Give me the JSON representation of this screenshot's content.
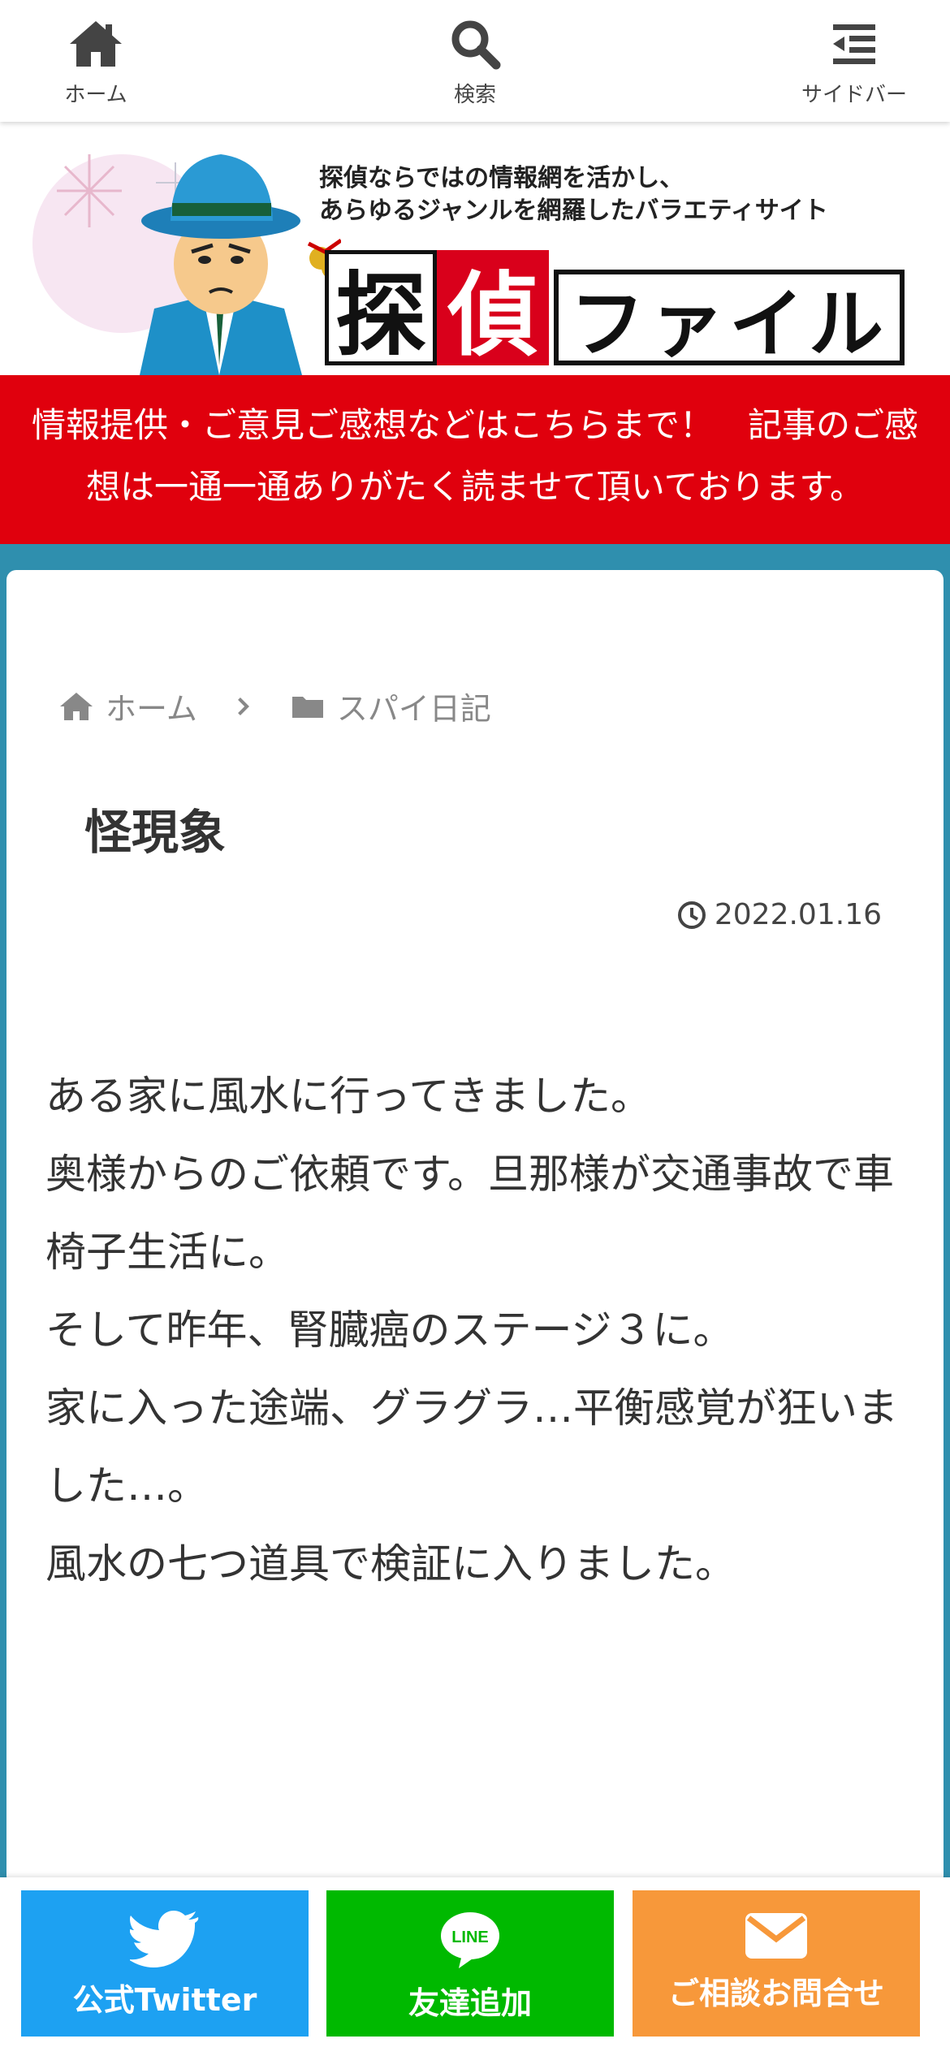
{
  "nav": {
    "home_label": "ホーム",
    "search_label": "検索",
    "sidebar_label": "サイドバー"
  },
  "header": {
    "tagline_line1": "探偵ならではの情報網を活かし、",
    "tagline_line2": "あらゆるジャンルを網羅したバラエティサイト",
    "logo_char1": "探",
    "logo_char2": "偵",
    "logo_kana": "ファイル"
  },
  "notice": {
    "text": "情報提供・ご意見ご感想などはこちらまで！　記事のご感想は一通一通ありがたく読ませて頂いております。"
  },
  "breadcrumb": {
    "home": "ホーム",
    "category": "スパイ日記"
  },
  "post": {
    "title": "怪現象",
    "date": "2022.01.16",
    "paragraphs": [
      "ある家に風水に行ってきました。",
      "奥様からのご依頼です。旦那様が交通事故で車椅子生活に。",
      "そして昨年、腎臓癌のステージ３に。",
      "家に入った途端、グラグラ…平衡感覚が狂いました…。",
      "風水の七つ道具で検証に入りました。"
    ]
  },
  "bottom": {
    "twitter_label": "公式Twitter",
    "line_label": "友達追加",
    "line_icon_text": "LINE",
    "mail_label": "ご相談お問合せ"
  },
  "colors": {
    "notice_red": "#e0000d",
    "content_blue": "#2f8fae",
    "twitter_blue": "#1da1f2",
    "line_green": "#00b900",
    "mail_orange": "#f7983a"
  }
}
